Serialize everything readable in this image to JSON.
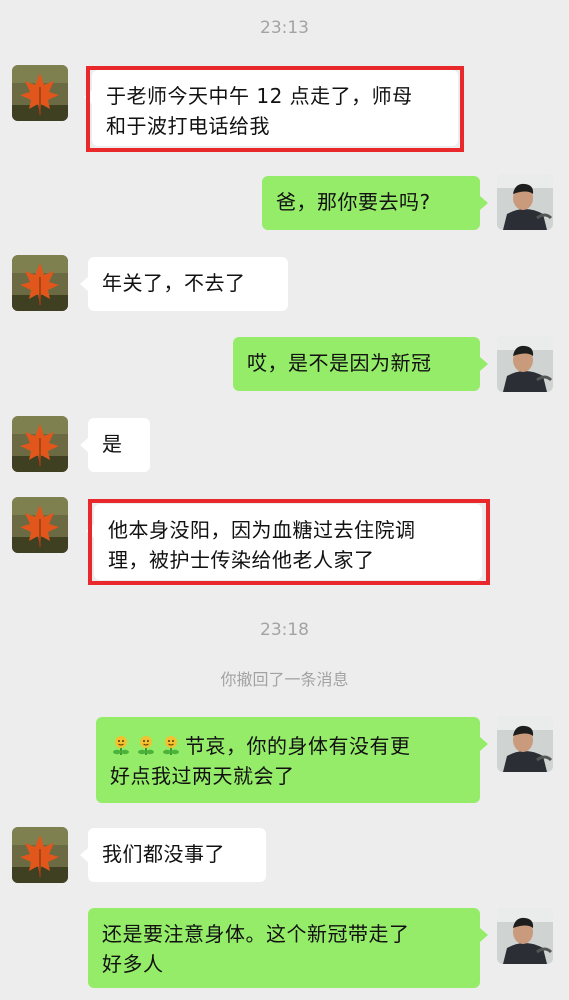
{
  "chat": {
    "times": [
      "23:13",
      "23:18"
    ],
    "system_notice": "你撤回了一条消息",
    "messages": [
      {
        "side": "left",
        "line1": "于老师今天中午 12 点走了，师母",
        "line2": "和于波打电话给我"
      },
      {
        "side": "right",
        "text": "爸，那你要去吗?"
      },
      {
        "side": "left",
        "text": "年关了，不去了"
      },
      {
        "side": "right",
        "text": "哎，是不是因为新冠"
      },
      {
        "side": "left",
        "text": "是"
      },
      {
        "side": "left",
        "line1": "他本身没阳，因为血糖过去住院调",
        "line2": "理，被护士传染给他老人家了"
      },
      {
        "side": "right",
        "line1": "节哀，你的身体有没有更",
        "line2": "好点我过两天就会了",
        "emoji": "three-flower-emoji"
      },
      {
        "side": "left",
        "text": "我们都没事了"
      },
      {
        "side": "right",
        "line1": "还是要注意身体。这个新冠带走了",
        "line2": "好多人"
      }
    ]
  },
  "colors": {
    "background": "#ededed",
    "self_bubble": "#95ec69",
    "other_bubble": "#ffffff",
    "highlight": "#e8282b"
  },
  "icons": {
    "left_avatar": "maple-leaf-avatar",
    "right_avatar": "man-driving-avatar"
  }
}
